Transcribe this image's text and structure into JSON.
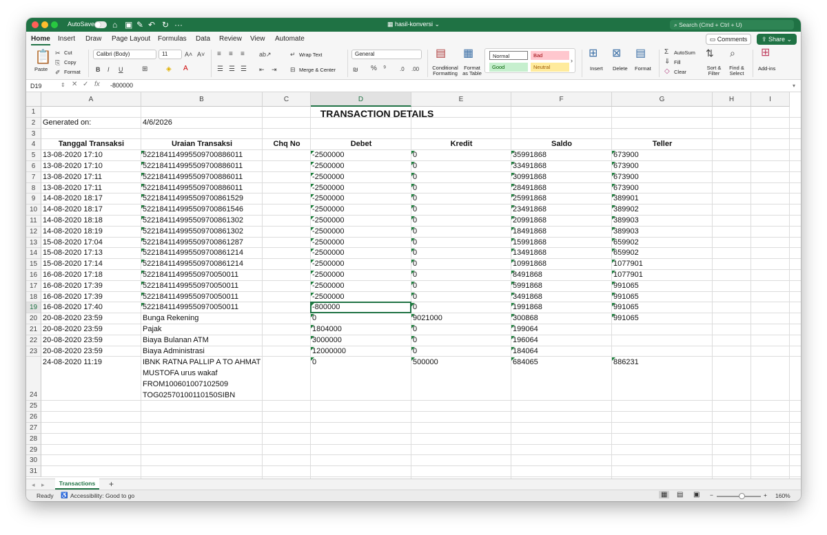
{
  "titlebar": {
    "autosave_label": "AutoSave",
    "doc_title": "hasil-konversi",
    "search_placeholder": "Search (Cmd + Ctrl + U)"
  },
  "menu": {
    "tabs": [
      "Home",
      "Insert",
      "Draw",
      "Page Layout",
      "Formulas",
      "Data",
      "Review",
      "View",
      "Automate"
    ],
    "active": "Home",
    "comments_label": "Comments",
    "share_label": "Share"
  },
  "ribbon": {
    "paste": "Paste",
    "cut": "Cut",
    "copy": "Copy",
    "format": "Format",
    "font_name": "Calibri (Body)",
    "font_size": "11",
    "wrap_text": "Wrap Text",
    "merge_center": "Merge & Center",
    "number_format": "General",
    "conditional_formatting": "Conditional Formatting",
    "format_as_table": "Format as Table",
    "styles": {
      "normal": "Normal",
      "bad": "Bad",
      "good": "Good",
      "neutral": "Neutral"
    },
    "insert": "Insert",
    "delete": "Delete",
    "format_cells": "Format",
    "autosum": "AutoSum",
    "fill": "Fill",
    "clear": "Clear",
    "sort_filter": "Sort & Filter",
    "find_select": "Find & Select",
    "add_ins": "Add-ins"
  },
  "formula_bar": {
    "name_box": "D19",
    "formula": "-800000"
  },
  "columns": [
    "A",
    "B",
    "C",
    "D",
    "E",
    "F",
    "G",
    "H",
    "I"
  ],
  "selected": {
    "column": "D",
    "row": 19
  },
  "sheet": {
    "title": "TRANSACTION DETAILS",
    "generated_label": "Generated on:",
    "generated_date": "4/6/2026",
    "headers": [
      "Tanggal Transaksi",
      "Uraian Transaksi",
      "Chq No",
      "Debet",
      "Kredit",
      "Saldo",
      "Teller"
    ],
    "rows": [
      [
        "13-08-2020 17:10",
        "5221841149955097008860​11",
        "",
        "-2500000",
        "0",
        "35991868",
        "673900"
      ],
      [
        "13-08-2020 17:10",
        "522184114995509700886011",
        "",
        "-2500000",
        "0",
        "33491868",
        "673900"
      ],
      [
        "13-08-2020 17:11",
        "522184114995509700886011",
        "",
        "-2500000",
        "0",
        "30991868",
        "673900"
      ],
      [
        "13-08-2020 17:11",
        "522184114995509700886011",
        "",
        "-2500000",
        "0",
        "28491868",
        "673900"
      ],
      [
        "14-08-2020 18:17",
        "522184114995509700861529",
        "",
        "-2500000",
        "0",
        "25991868",
        "389901"
      ],
      [
        "14-08-2020 18:17",
        "522184114995509700861546",
        "",
        "-2500000",
        "0",
        "23491868",
        "389902"
      ],
      [
        "14-08-2020 18:18",
        "522184114995509700861302",
        "",
        "-2500000",
        "0",
        "20991868",
        "389903"
      ],
      [
        "14-08-2020 18:19",
        "522184114995509700861302",
        "",
        "-2500000",
        "0",
        "18491868",
        "389903"
      ],
      [
        "15-08-2020 17:04",
        "522184114995509700861287",
        "",
        "-2500000",
        "0",
        "15991868",
        "659902"
      ],
      [
        "15-08-2020 17:13",
        "522184114995509700861214",
        "",
        "-2500000",
        "0",
        "13491868",
        "659902"
      ],
      [
        "15-08-2020 17:14",
        "522184114995509700861214",
        "",
        "-2500000",
        "0",
        "10991868",
        "1077901"
      ],
      [
        "16-08-2020 17:18",
        "5221841149955097005001​1",
        "",
        "-2500000",
        "0",
        "8491868",
        "1077901"
      ],
      [
        "16-08-2020 17:39",
        "52218411499550970050011",
        "",
        "-2500000",
        "0",
        "5991868",
        "991065"
      ],
      [
        "16-08-2020 17:39",
        "52218411499550970050011",
        "",
        "-2500000",
        "0",
        "3491868",
        "991065"
      ],
      [
        "16-08-2020 17:40",
        "52218411499550970050011",
        "",
        "-800000",
        "0",
        "1991868",
        "991065"
      ],
      [
        "20-08-2020 23:59",
        "Bunga Rekening",
        "",
        "0",
        "9021000",
        "300868",
        "991065"
      ],
      [
        "20-08-2020 23:59",
        "Pajak",
        "",
        "1804000",
        "0",
        "199064",
        ""
      ],
      [
        "20-08-2020 23:59",
        "Biaya Bulanan ATM",
        "",
        "3000000",
        "0",
        "196064",
        ""
      ],
      [
        "20-08-2020 23:59",
        "Biaya Administrasi",
        "",
        "12000000",
        "0",
        "184064",
        ""
      ]
    ],
    "row24": {
      "date": "24-08-2020 11:19",
      "desc_lines": [
        "IBNK RATNA PALLIP A TO AHMAT",
        "MUSTOFA urus wakaf",
        "FROM100601007102509",
        "TOG02570100110150SIBN"
      ],
      "debet": "0",
      "kredit": "500000",
      "saldo": "684065",
      "teller": "886231"
    }
  },
  "sheet_tab": "Transactions",
  "status": {
    "ready": "Ready",
    "accessibility": "Accessibility: Good to go",
    "zoom": "160%"
  }
}
